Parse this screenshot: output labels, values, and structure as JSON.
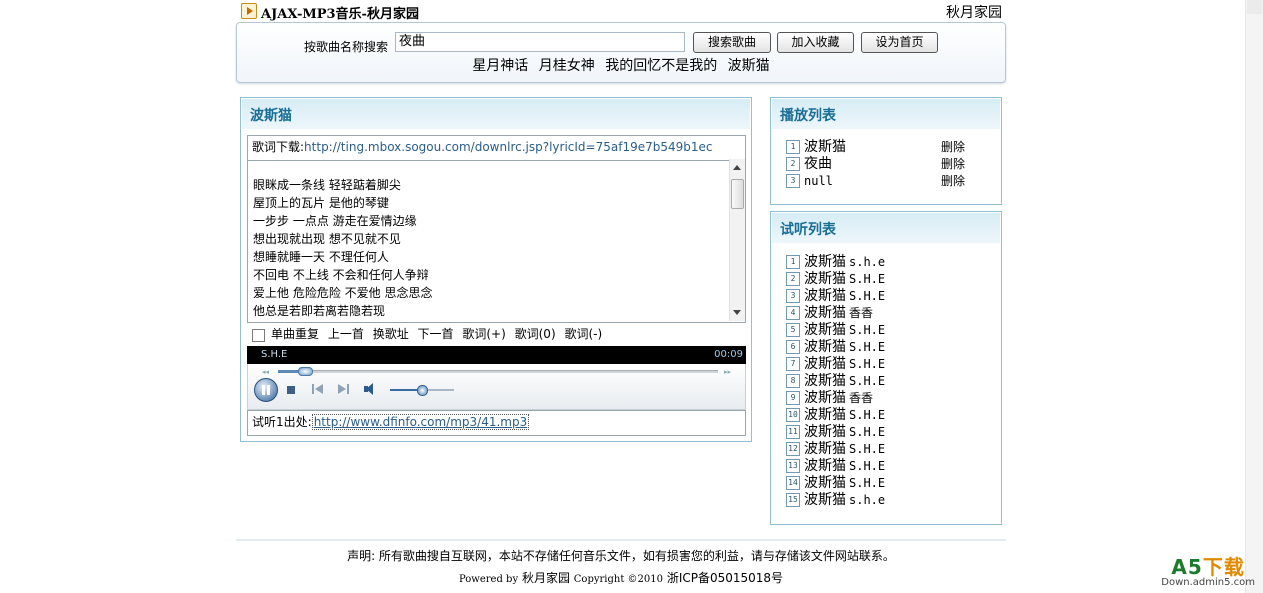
{
  "header": {
    "site_title": "AJAX-MP3音乐-秋月家园",
    "home_link": "秋月家园"
  },
  "search": {
    "label": "按歌曲名称搜索",
    "value": "夜曲",
    "search_button": "搜索歌曲",
    "favorite_button": "加入收藏",
    "homepage_button": "设为首页",
    "hot_words": [
      "星月神话",
      "月桂女神",
      "我的回忆不是我的",
      "波斯猫"
    ]
  },
  "main": {
    "title": "波斯猫",
    "lyric_download_label": "歌词下载:",
    "lyric_download_url": "http://ting.mbox.sogou.com/downlrc.jsp?lyricId=75af19e7b549b1ec",
    "lyrics": [
      "眼眯成一条线 轻轻踮着脚尖",
      "屋顶上的瓦片 是他的琴键",
      "一步步 一点点 游走在爱情边缘",
      "想出现就出现 想不见就不见",
      "想睡就睡一天 不理任何人",
      "不回电 不上线 不会和任何人争辩",
      "爱上他 危险危险 不爱他 思念思念",
      "他总是若即若离若隐若现"
    ],
    "controls": {
      "repeat_label": "单曲重复",
      "prev": "上一首",
      "change_url": "换歌址",
      "next": "下一首",
      "lyric_plus": "歌词(+)",
      "lyric_zero": "歌词(0)",
      "lyric_minus": "歌词(-)"
    },
    "player": {
      "song": "S.H.E",
      "time": "00:09",
      "progress": 0.06,
      "volume": 0.5
    },
    "source_label": "试听1出处:",
    "source_url": "http://www.dfinfo.com/mp3/41.mp3"
  },
  "playlist": {
    "title": "播放列表",
    "delete_label": "删除",
    "items": [
      {
        "num": "1",
        "name": "波斯猫"
      },
      {
        "num": "2",
        "name": "夜曲"
      },
      {
        "num": "3",
        "name": "null"
      }
    ]
  },
  "trial": {
    "title": "试听列表",
    "items": [
      {
        "num": "1",
        "name": "波斯猫",
        "singer": "s.h.e"
      },
      {
        "num": "2",
        "name": "波斯猫",
        "singer": "S.H.E"
      },
      {
        "num": "3",
        "name": "波斯猫",
        "singer": "S.H.E"
      },
      {
        "num": "4",
        "name": "波斯猫",
        "singer": "香香"
      },
      {
        "num": "5",
        "name": "波斯猫",
        "singer": "S.H.E"
      },
      {
        "num": "6",
        "name": "波斯猫",
        "singer": "S.H.E"
      },
      {
        "num": "7",
        "name": "波斯猫",
        "singer": "S.H.E"
      },
      {
        "num": "8",
        "name": "波斯猫",
        "singer": "S.H.E"
      },
      {
        "num": "9",
        "name": "波斯猫",
        "singer": "香香"
      },
      {
        "num": "10",
        "name": "波斯猫",
        "singer": "S.H.E"
      },
      {
        "num": "11",
        "name": "波斯猫",
        "singer": "S.H.E"
      },
      {
        "num": "12",
        "name": "波斯猫",
        "singer": "S.H.E"
      },
      {
        "num": "13",
        "name": "波斯猫",
        "singer": "S.H.E"
      },
      {
        "num": "14",
        "name": "波斯猫",
        "singer": "S.H.E"
      },
      {
        "num": "15",
        "name": "波斯猫",
        "singer": "s.h.e"
      }
    ]
  },
  "footer": {
    "disclaimer": "声明: 所有歌曲搜自互联网，本站不存储任何音乐文件，如有损害您的利益，请与存储该文件网站联系。",
    "powered_prefix": "Powered by",
    "powered_site": "秋月家园",
    "copyright": "Copyright ©2010",
    "icp": "浙ICP备05015018号"
  },
  "watermark": {
    "brand_a5": "A5",
    "brand_dl": "下载",
    "domain": "Down.admin5.com"
  }
}
